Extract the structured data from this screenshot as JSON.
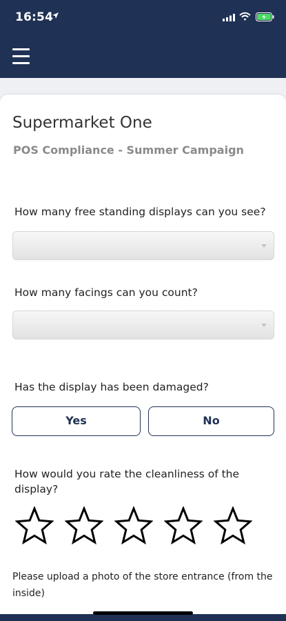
{
  "status_bar": {
    "time": "16:54",
    "icons": [
      "location-arrow-icon",
      "signal-icon",
      "wifi-icon",
      "battery-icon"
    ]
  },
  "nav": {
    "menu_icon": "hamburger-menu-icon"
  },
  "colors": {
    "brand": "#1f3154",
    "background": "#eef0f4",
    "card": "#ffffff",
    "subtitle": "#8a8a8a"
  },
  "store": {
    "name": "Supermarket One",
    "campaign": "POS Compliance - Summer Campaign"
  },
  "questions": {
    "displays": {
      "label": "How many free standing displays can you see?",
      "value": ""
    },
    "facings": {
      "label": "How many facings can you count?",
      "value": ""
    },
    "damaged": {
      "label": "Has the display has been damaged?",
      "yes_label": "Yes",
      "no_label": "No"
    },
    "cleanliness": {
      "label": "How would you rate the cleanliness of the display?",
      "rating": 0,
      "max_rating": 5
    },
    "photo": {
      "label": "Please upload a photo of the store entrance (from the inside)"
    }
  }
}
